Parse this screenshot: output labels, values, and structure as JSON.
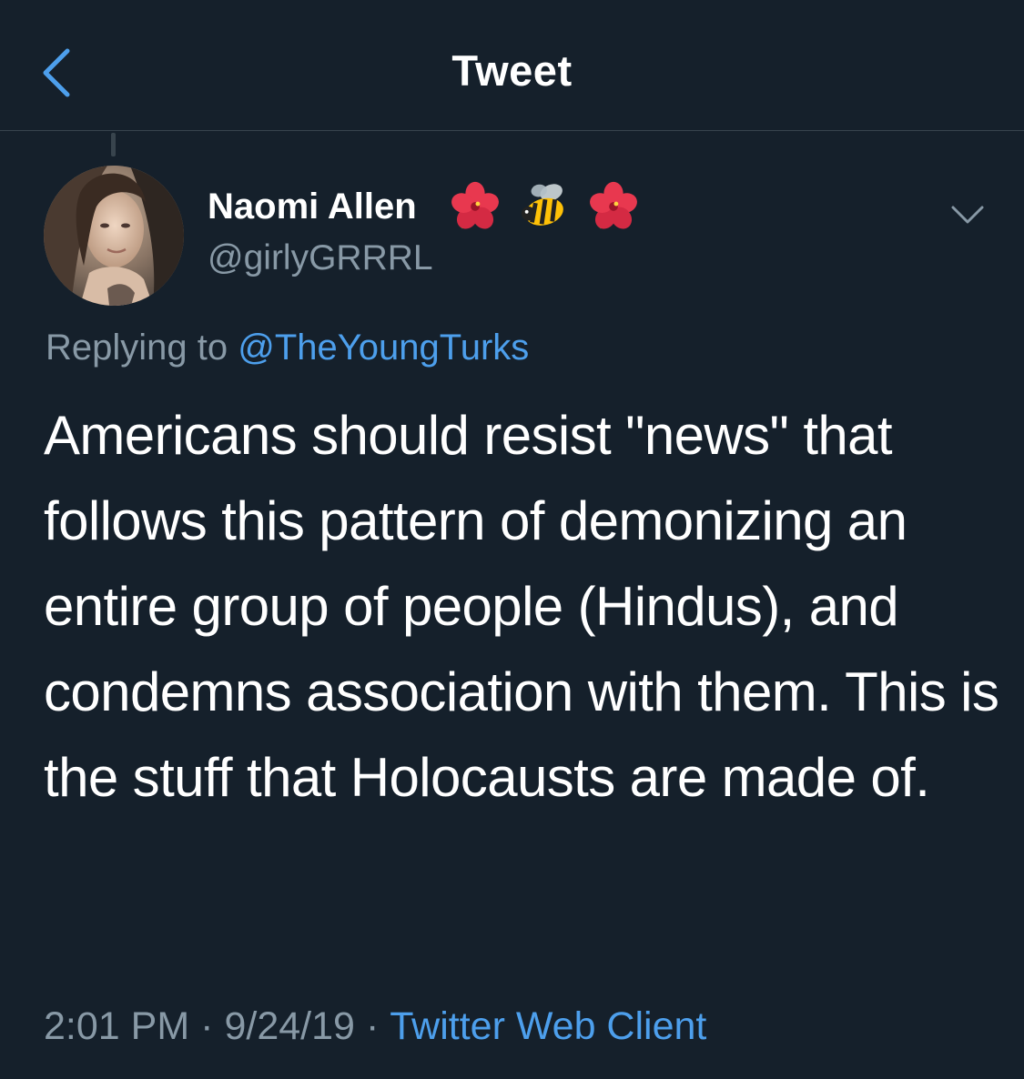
{
  "header": {
    "title": "Tweet",
    "back_icon": "chevron-left-icon"
  },
  "author": {
    "display_name": "Naomi Allen",
    "handle": "@girlyGRRRL",
    "name_emojis": [
      "hibiscus-icon",
      "bee-icon",
      "hibiscus-icon"
    ]
  },
  "reply": {
    "prefix": "Replying to",
    "target": "@TheYoungTurks"
  },
  "tweet": {
    "text": "Americans should resist \"news\" that follows this pattern of demonizing an entire group of people (Hindus), and condemns association with them. This is the stuff that Holocausts are made of."
  },
  "meta": {
    "time": "2:01 PM",
    "date": "9/24/19",
    "separator": "·",
    "source": "Twitter Web Client"
  },
  "colors": {
    "background": "#15202b",
    "link": "#4d9fec",
    "secondary_text": "#8899a6",
    "divider": "#38444d"
  }
}
